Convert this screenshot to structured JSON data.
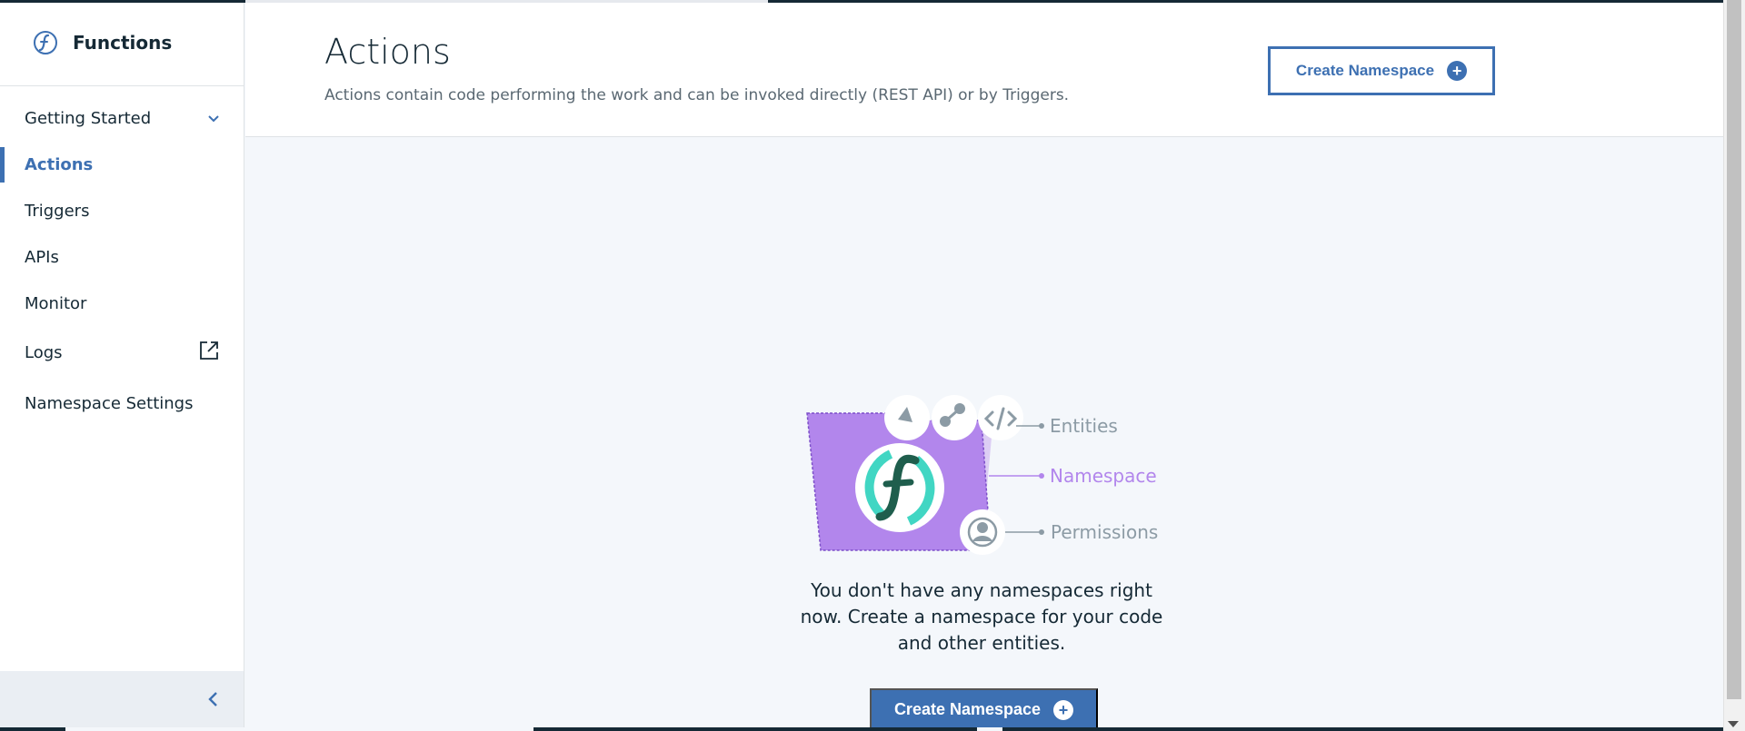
{
  "app": {
    "title": "Functions"
  },
  "sidebar": {
    "items": [
      {
        "label": "Getting Started"
      },
      {
        "label": "Actions"
      },
      {
        "label": "Triggers"
      },
      {
        "label": "APIs"
      },
      {
        "label": "Monitor"
      },
      {
        "label": "Logs"
      },
      {
        "label": "Namespace Settings"
      }
    ]
  },
  "header": {
    "title": "Actions",
    "description": "Actions contain code performing the work and can be invoked directly (REST API) or by Triggers.",
    "create_label": "Create Namespace"
  },
  "empty_state": {
    "labels": {
      "entities": "Entities",
      "namespace": "Namespace",
      "permissions": "Permissions"
    },
    "message": "You don't have any namespaces right now. Create a namespace for your code and other entities.",
    "create_label": "Create Namespace"
  },
  "icons": {
    "logo": "functions-logo-icon",
    "expand": "chevron-down-icon",
    "external": "external-link-icon",
    "collapse": "chevron-left-icon",
    "add": "plus-circle-icon"
  },
  "colors": {
    "accent": "#3d70b2",
    "folder": "#b286ec",
    "brand_green": "#41d6c3",
    "label_gray": "#8c9ba5",
    "label_purple": "#b286ec"
  }
}
